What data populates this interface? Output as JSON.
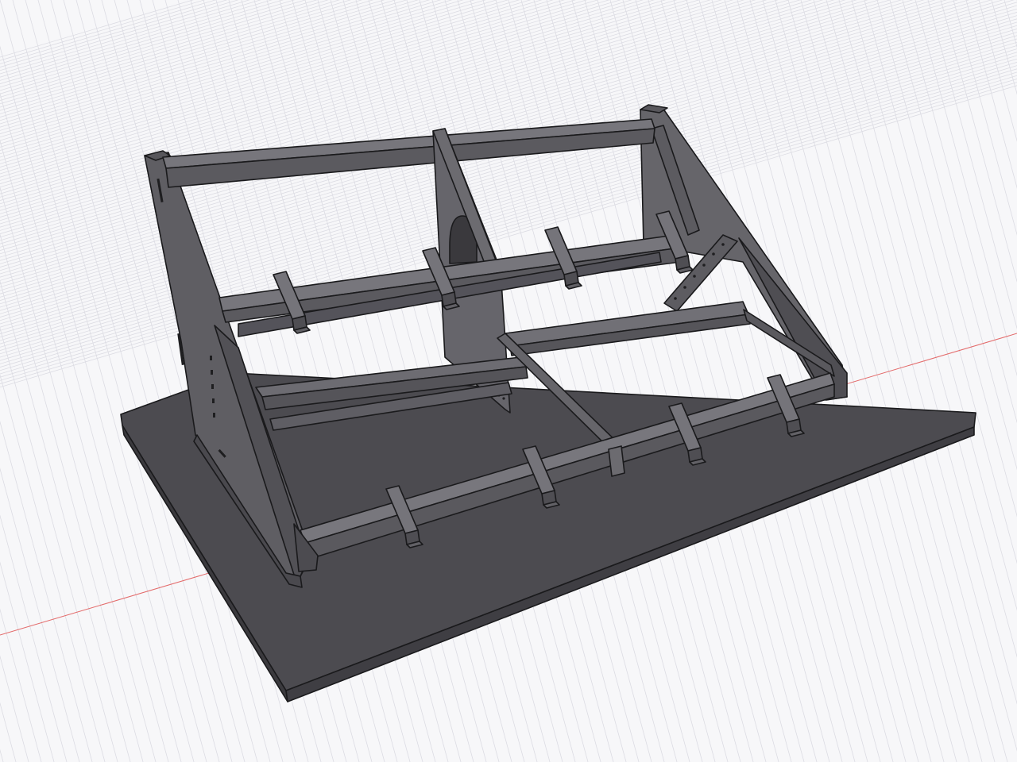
{
  "viewport": {
    "background": "#f7f7f9",
    "grid_minor_color": "#dcdce2",
    "grid_major_color": "#c9c9d1",
    "axis_x_color": "#e05a5a"
  },
  "model": {
    "name": "",
    "body_color": "#5a595e",
    "edge_color": "#1a1a1c",
    "base_plate_color": "#4a494e",
    "shelf_bracket_count": 10,
    "support_rail_count": 4
  }
}
